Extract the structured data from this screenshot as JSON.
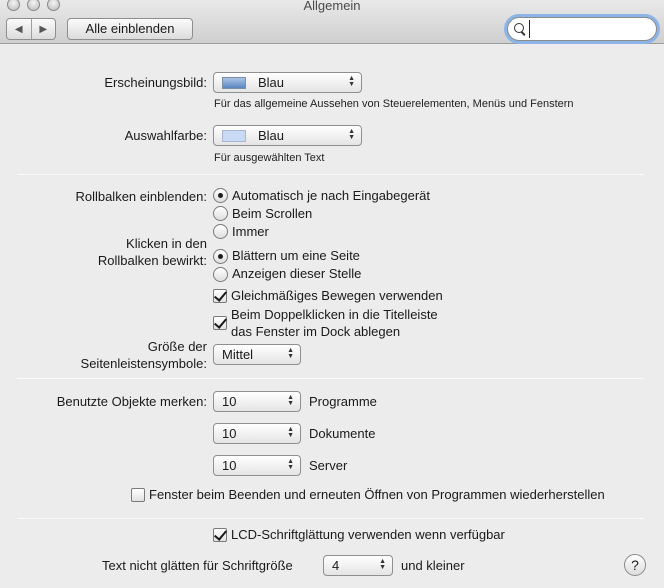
{
  "window": {
    "title": "Allgemein"
  },
  "toolbar": {
    "back_icon": "◀",
    "forward_icon": "▶",
    "show_all_label": "Alle einblenden",
    "search_value": "",
    "search_placeholder": ""
  },
  "appearance": {
    "label": "Erscheinungsbild:",
    "value": "Blau",
    "hint": "Für das allgemeine Aussehen von Steuerelementen, Menüs und Fenstern"
  },
  "highlight": {
    "label": "Auswahlfarbe:",
    "value": "Blau",
    "hint": "Für ausgewählten Text"
  },
  "scrollbars": {
    "label": "Rollbalken einblenden:",
    "options": [
      "Automatisch je nach Eingabegerät",
      "Beim Scrollen",
      "Immer"
    ],
    "selected": 0
  },
  "click": {
    "label_line1": "Klicken in den",
    "label_line2": "Rollbalken bewirkt:",
    "options": [
      "Blättern um eine Seite",
      "Anzeigen dieser Stelle"
    ],
    "selected": 0
  },
  "smooth_scroll": {
    "label": "Gleichmäßiges Bewegen verwenden",
    "checked": true
  },
  "double_click": {
    "line1": "Beim Doppelklicken in die Titelleiste",
    "line2": "das Fenster im Dock ablegen",
    "checked": true
  },
  "sidebar_size": {
    "label_line1": "Größe der",
    "label_line2": "Seitenleistensymbole:",
    "value": "Mittel"
  },
  "recent": {
    "label": "Benutzte Objekte merken:",
    "rows": [
      {
        "value": "10",
        "unit": "Programme"
      },
      {
        "value": "10",
        "unit": "Dokumente"
      },
      {
        "value": "10",
        "unit": "Server"
      }
    ]
  },
  "restore_windows": {
    "label": "Fenster beim Beenden und erneuten Öffnen von Programmen wiederherstellen",
    "checked": false
  },
  "lcd": {
    "label": "LCD-Schriftglättung verwenden wenn verfügbar",
    "checked": true
  },
  "font_smoothing": {
    "label": "Text nicht glätten für Schriftgröße",
    "value": "4",
    "suffix": "und kleiner"
  },
  "help": {
    "label": "?"
  },
  "colors": {
    "focus_ring": "#8cb4e6",
    "background": "#ececec",
    "swatch_blue": "#5b86c0"
  }
}
